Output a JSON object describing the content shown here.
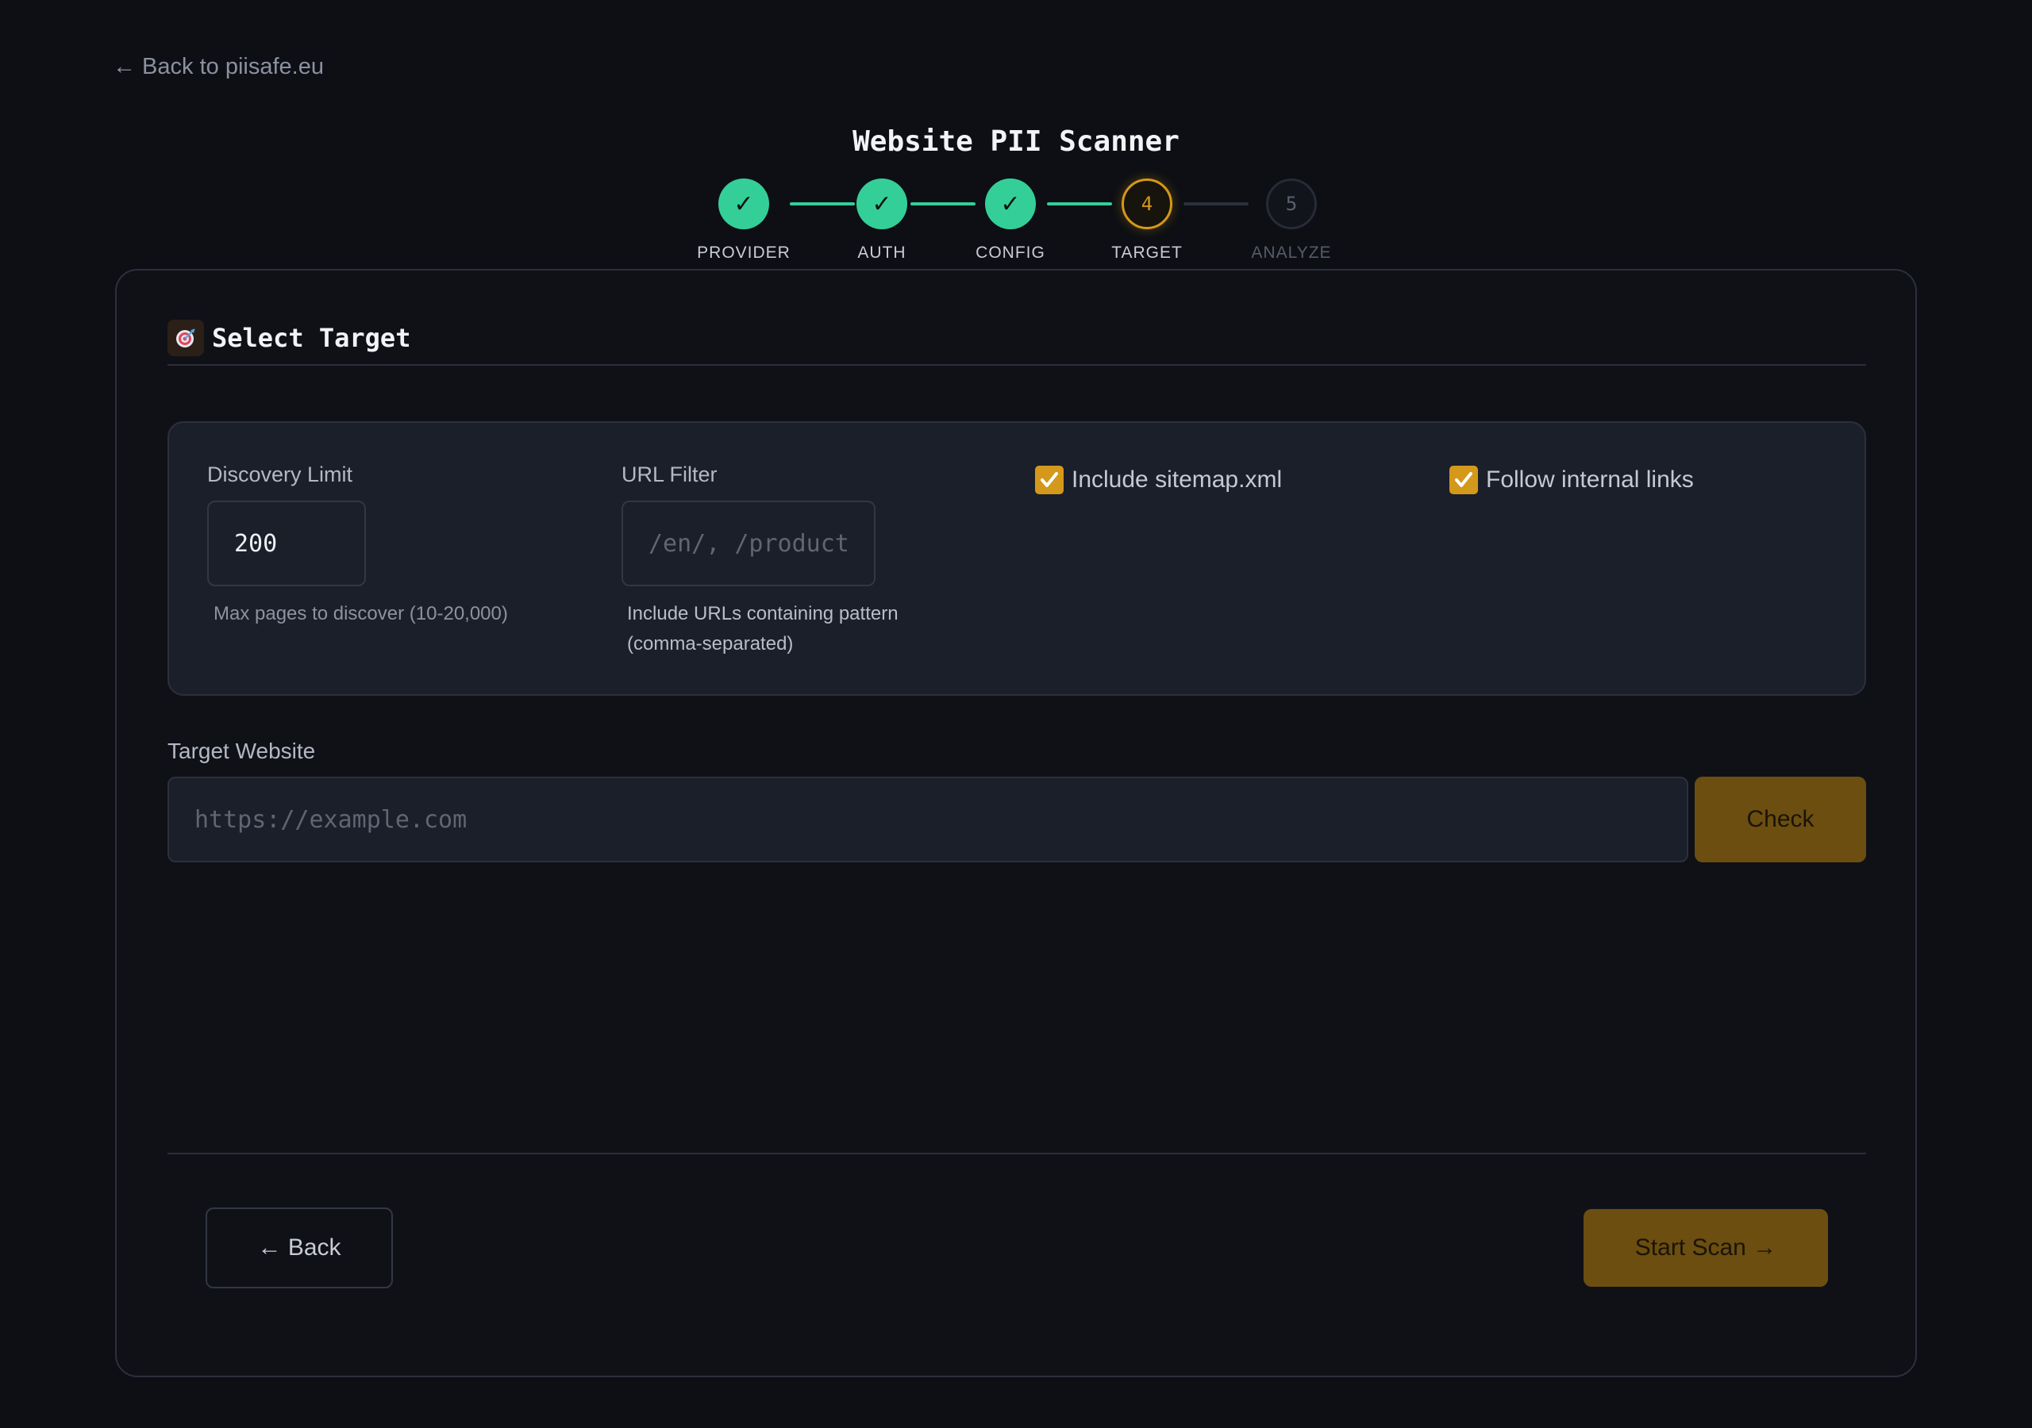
{
  "nav": {
    "back_link": "← Back to piisafe.eu"
  },
  "page": {
    "title": "Website PII Scanner"
  },
  "stepper": {
    "steps": [
      {
        "label": "PROVIDER",
        "marker": "✓",
        "state": "done"
      },
      {
        "label": "AUTH",
        "marker": "✓",
        "state": "done"
      },
      {
        "label": "CONFIG",
        "marker": "✓",
        "state": "done"
      },
      {
        "label": "TARGET",
        "marker": "4",
        "state": "active"
      },
      {
        "label": "ANALYZE",
        "marker": "5",
        "state": "todo"
      }
    ]
  },
  "section": {
    "icon": "target-icon",
    "title": "Select Target"
  },
  "options": {
    "discovery_limit": {
      "label": "Discovery Limit",
      "value": "200",
      "help": "Max pages to discover (10-20,000)"
    },
    "url_filter": {
      "label": "URL Filter",
      "placeholder": "/en/, /product",
      "help_line1": "Include URLs containing pattern",
      "help_line2": "(comma-separated)"
    },
    "include_sitemap": {
      "label": "Include sitemap.xml",
      "checked": true
    },
    "follow_links": {
      "label": "Follow internal links",
      "checked": true
    }
  },
  "target": {
    "label": "Target Website",
    "placeholder": "https://example.com",
    "check_label": "Check"
  },
  "footer": {
    "back_label": "← Back",
    "start_label": "Start Scan →"
  },
  "colors": {
    "background": "#0d0f14",
    "accent": "#d4981a",
    "success": "#34cf98",
    "button_fill": "#6b4e10"
  }
}
